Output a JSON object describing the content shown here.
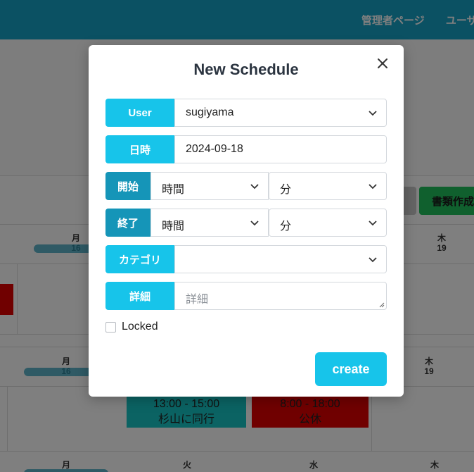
{
  "topnav": {
    "items": [
      "管理者ページ",
      "ユーザ"
    ]
  },
  "background": {
    "doc_button": "書類作成",
    "cal1": {
      "mon_day": "月",
      "mon_date": "16",
      "thu_day": "木",
      "thu_date": "19"
    },
    "cal2": {
      "mon_day": "月",
      "mon_date": "16",
      "thu_day": "木",
      "thu_date": "19",
      "event1_time": "13:00 - 15:00",
      "event1_title": "杉山に同行",
      "event2_time": "8:00 - 18:00",
      "event2_title": "公休"
    },
    "cal3": {
      "mon_day": "月",
      "tue_day": "火",
      "wed_day": "水",
      "thu_day": "木"
    }
  },
  "modal": {
    "title": "New Schedule",
    "user": {
      "label": "User",
      "value": "sugiyama"
    },
    "date": {
      "label": "日時",
      "value": "2024-09-18"
    },
    "start": {
      "label": "開始",
      "hour": "時間",
      "minute": "分"
    },
    "end": {
      "label": "終了",
      "hour": "時間",
      "minute": "分"
    },
    "category": {
      "label": "カテゴリ",
      "value": ""
    },
    "detail": {
      "label": "詳細",
      "placeholder": "詳細"
    },
    "locked_label": "Locked",
    "create_label": "create"
  },
  "colors": {
    "accent": "#17c4ea",
    "accent_dark": "#1595b8",
    "topbar": "#17a2c7",
    "danger": "#e00000",
    "success": "#20c05c"
  }
}
